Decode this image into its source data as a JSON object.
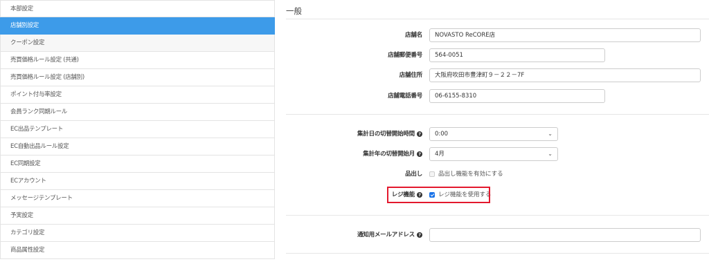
{
  "sidebar": {
    "items": [
      {
        "label": "本部設定"
      },
      {
        "label": "店舗別設定"
      },
      {
        "label": "クーポン設定"
      },
      {
        "label": "売買価格ルール設定 (共通)"
      },
      {
        "label": "売買価格ルール設定 (店舗別)"
      },
      {
        "label": "ポイント付与率設定"
      },
      {
        "label": "会員ランク同期ルール"
      },
      {
        "label": "EC出品テンプレート"
      },
      {
        "label": "EC自動出品ルール設定"
      },
      {
        "label": "EC同期設定"
      },
      {
        "label": "ECアカウント"
      },
      {
        "label": "メッセージテンプレート"
      },
      {
        "label": "予実設定"
      },
      {
        "label": "カテゴリ設定"
      },
      {
        "label": "商品属性設定"
      }
    ]
  },
  "main": {
    "section_title": "一般",
    "store_name": {
      "label": "店舗名",
      "value": "NOVASTO ReCORE店"
    },
    "postal_code": {
      "label": "店舗郵便番号",
      "value": "564-0051"
    },
    "address": {
      "label": "店舗住所",
      "value": "大阪府吹田市豊津町９－２２－7F"
    },
    "phone": {
      "label": "店舗電話番号",
      "value": "06-6155-8310"
    },
    "aggregate_day": {
      "label": "集計日の切替開始時間",
      "value": "0:00"
    },
    "aggregate_year": {
      "label": "集計年の切替開始月",
      "value": "4月"
    },
    "item_out": {
      "label": "品出し",
      "checkbox_label": "品出し機能を有効にする",
      "checked": false
    },
    "register": {
      "label": "レジ機能",
      "checkbox_label": "レジ機能を使用する",
      "checked": true
    },
    "notify_email": {
      "label": "通知用メールアドレス",
      "value": ""
    }
  },
  "colors": {
    "active": "#3d9be9",
    "highlight": "#e3182d",
    "checkbox": "#1a73e8"
  }
}
